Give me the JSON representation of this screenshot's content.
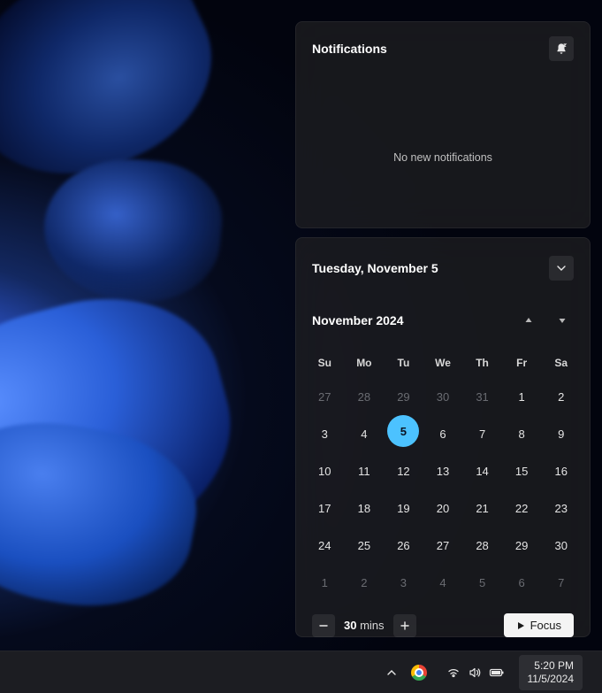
{
  "notifications": {
    "title": "Notifications",
    "empty_message": "No new notifications"
  },
  "calendar": {
    "selected_date_label": "Tuesday, November 5",
    "month_label": "November 2024",
    "day_headers": [
      "Su",
      "Mo",
      "Tu",
      "We",
      "Th",
      "Fr",
      "Sa"
    ],
    "weeks": [
      [
        {
          "d": "27",
          "o": true
        },
        {
          "d": "28",
          "o": true
        },
        {
          "d": "29",
          "o": true
        },
        {
          "d": "30",
          "o": true
        },
        {
          "d": "31",
          "o": true
        },
        {
          "d": "1"
        },
        {
          "d": "2"
        }
      ],
      [
        {
          "d": "3"
        },
        {
          "d": "4"
        },
        {
          "d": "5",
          "today": true
        },
        {
          "d": "6"
        },
        {
          "d": "7"
        },
        {
          "d": "8"
        },
        {
          "d": "9"
        }
      ],
      [
        {
          "d": "10"
        },
        {
          "d": "11"
        },
        {
          "d": "12"
        },
        {
          "d": "13"
        },
        {
          "d": "14"
        },
        {
          "d": "15"
        },
        {
          "d": "16"
        }
      ],
      [
        {
          "d": "17"
        },
        {
          "d": "18"
        },
        {
          "d": "19"
        },
        {
          "d": "20"
        },
        {
          "d": "21"
        },
        {
          "d": "22"
        },
        {
          "d": "23"
        }
      ],
      [
        {
          "d": "24"
        },
        {
          "d": "25"
        },
        {
          "d": "26"
        },
        {
          "d": "27"
        },
        {
          "d": "28"
        },
        {
          "d": "29"
        },
        {
          "d": "30"
        }
      ],
      [
        {
          "d": "1",
          "o": true
        },
        {
          "d": "2",
          "o": true
        },
        {
          "d": "3",
          "o": true
        },
        {
          "d": "4",
          "o": true
        },
        {
          "d": "5",
          "o": true
        },
        {
          "d": "6",
          "o": true
        },
        {
          "d": "7",
          "o": true
        }
      ]
    ]
  },
  "focus": {
    "duration_value": "30",
    "duration_unit": "mins",
    "button_label": "Focus"
  },
  "taskbar": {
    "time": "5:20 PM",
    "date": "11/5/2024"
  }
}
